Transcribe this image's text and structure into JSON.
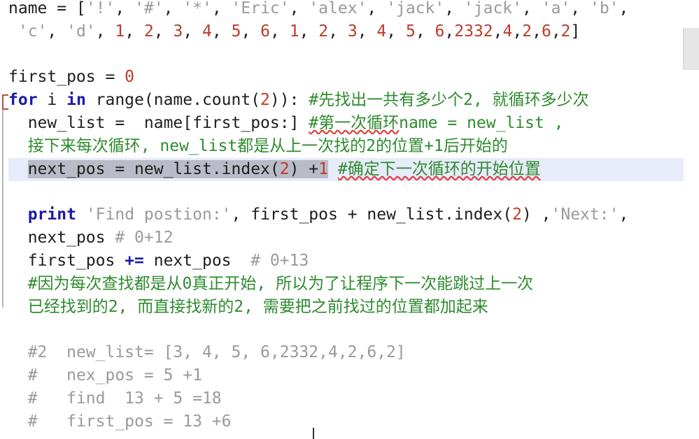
{
  "lines": {
    "l1": {
      "pre": "name = [",
      "s_bang": "'!'",
      "s_hash": "'#'",
      "s_star": "'*'",
      "s_eric": "'Eric'",
      "s_alex": "'alex'",
      "s_jack1": "'jack'",
      "s_jack2": "'jack'",
      "s_a": "'a'",
      "s_b": "'b'",
      "sep": ", ",
      "tail": ","
    },
    "l2": {
      "indent": " ",
      "s_c": "'c'",
      "s_d": "'d'",
      "nums": [
        "1",
        "2",
        "3",
        "4",
        "5",
        "6",
        "1",
        "2",
        "3",
        "4",
        "5",
        "6",
        "2332",
        "4",
        "2",
        "6",
        "2"
      ],
      "sep": ", ",
      "sep_tight": ",",
      "end": "]"
    },
    "l4": {
      "a": "first_pos = ",
      "b": "0"
    },
    "l5": {
      "kw_for": "for",
      "sp1": " i ",
      "kw_in": "in",
      "sp2": " range(name.count(",
      "num": "2",
      "close": ")): ",
      "comment": "#先找出一共有多少个2, 就循环多少次"
    },
    "l6": {
      "indent": "  ",
      "code": "new_list =  name[first_pos:] ",
      "comment_a": "#第一次循环",
      "comment_b": "name = new_list ,"
    },
    "l7": {
      "indent": "  ",
      "comment": "接下来每次循环, new_list都是从上一次找的2的位置+1后开始的"
    },
    "l8": {
      "indent": "  ",
      "code_sel": "next_pos = new_list.index(",
      "num1": "2",
      "close_sel": ") +",
      "num2": "1",
      "sp": " ",
      "comment": "#确定下一次循环的开始位置"
    },
    "l10": {
      "indent": "  ",
      "kw_print": "print",
      "sp": " ",
      "str1": "'Find postion:'",
      "mid": ", first_pos + new_list.index(",
      "num": "2",
      "mid2": ") ,",
      "str2": "'Next:'",
      "tail": ","
    },
    "l11": {
      "indent": "  ",
      "code": "next_pos ",
      "comment": "# 0+12"
    },
    "l12": {
      "indent": "  ",
      "code": "first_pos ",
      "op": "+=",
      "code2": " next_pos  ",
      "comment": "# 0+13"
    },
    "l13": {
      "indent": "  ",
      "comment": "#因为每次查找都是从0真正开始, 所以为了让程序下一次能跳过上一次"
    },
    "l14": {
      "indent": "  ",
      "comment": "已经找到的2, 而直接找新的2, 需要把之前找过的位置都加起来"
    },
    "l16": {
      "indent": "  ",
      "comment": "#2  new_list= [3, 4, 5, 6,2332,4,2,6,2]"
    },
    "l17": {
      "indent": "  ",
      "comment": "#   nex_pos = 5 +1"
    },
    "l18": {
      "indent": "  ",
      "comment": "#   find  13 + 5 =18"
    },
    "l19": {
      "indent": "  ",
      "comment": "#   first_pos = 13 +6"
    }
  },
  "colors": {
    "keyword": "#1a1aa6",
    "string": "#9a9a9a",
    "number": "#c0392b",
    "comment": "#2e8b2e",
    "current_line": "#e8ecfa",
    "selection": "#b9bcc8"
  }
}
